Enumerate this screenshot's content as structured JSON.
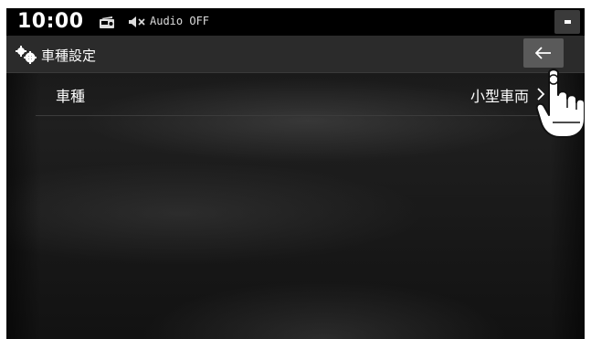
{
  "status": {
    "time": "10:00",
    "audio_text": "Audio OFF",
    "radio_icon": "fm-radio-icon",
    "mute_icon": "speaker-mute-icon"
  },
  "header": {
    "title": "車種設定",
    "icon": "gear-icon",
    "back_icon": "arrow-left-icon"
  },
  "settings": {
    "rows": [
      {
        "label": "車種",
        "value": "小型車両"
      }
    ]
  },
  "colors": {
    "status_bar": "#000000",
    "header_bar": "#2b2b2b",
    "back_button": "#5a5a5a",
    "text": "#ffffff"
  }
}
